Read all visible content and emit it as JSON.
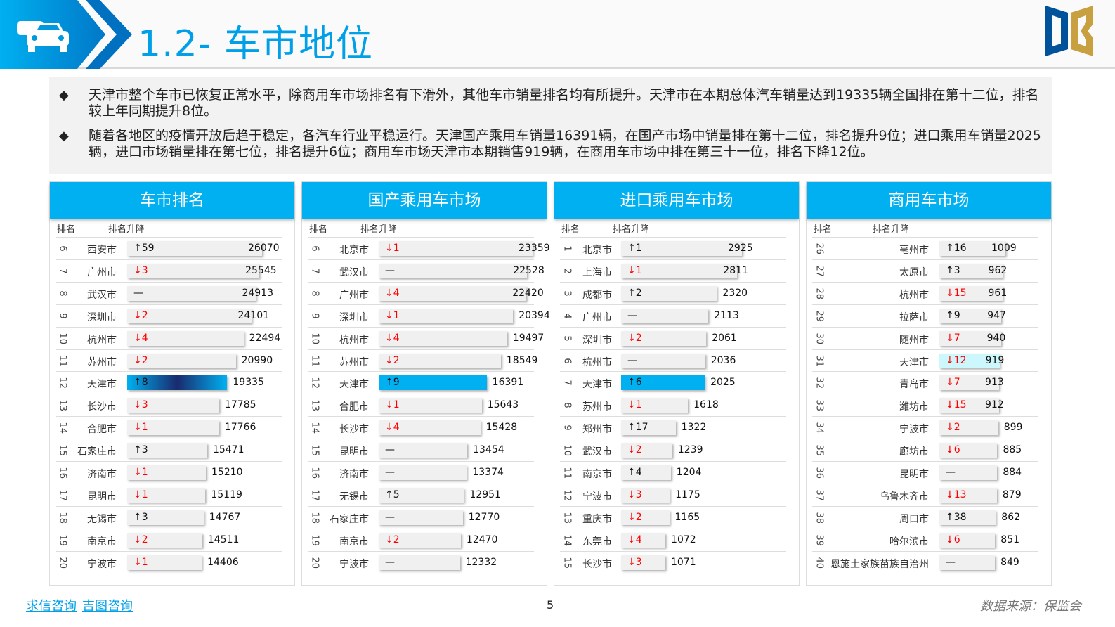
{
  "header": {
    "title": "1.2- 车市地位",
    "icon": "cars-icon",
    "logo": "DB"
  },
  "summary": [
    "天津市整个车市已恢复正常水平，除商用车市场排名有下滑外，其他车市销量排名均有所提升。天津市在本期总体汽车销量达到19335辆全国排在第十二位，排名较上年同期提升8位。",
    "随着各地区的疫情开放后趋于稳定，各汽车行业平稳运行。天津国产乘用车销量16391辆，在国产市场中销量排在第十二位，排名提升9位；进口乘用车销量2025辆，进口市场销量排在第七位，排名提升6位；商用车市场天津市本期销售919辆，在商用车市场中排在第三十一位，排名下降12位。"
  ],
  "colors": {
    "accent": "#00b0f0",
    "down": "#ff0000",
    "up": "#111111",
    "highlight_commercial": "#ccf7fc"
  },
  "panels": [
    {
      "title": "车市排名",
      "col_rank": "排名",
      "col_change": "排名升降",
      "highlight": "天津市",
      "rows": [
        [
          6,
          "西安市",
          "↑59",
          26070
        ],
        [
          7,
          "广州市",
          "↓3",
          25545
        ],
        [
          8,
          "武汉市",
          "—",
          24913
        ],
        [
          9,
          "深圳市",
          "↓2",
          24101
        ],
        [
          10,
          "杭州市",
          "↓4",
          22494
        ],
        [
          11,
          "苏州市",
          "↓2",
          20990
        ],
        [
          12,
          "天津市",
          "↑8",
          19335
        ],
        [
          13,
          "长沙市",
          "↓3",
          17785
        ],
        [
          14,
          "合肥市",
          "↓1",
          17766
        ],
        [
          15,
          "石家庄市",
          "↑3",
          15471
        ],
        [
          16,
          "济南市",
          "↓1",
          15210
        ],
        [
          17,
          "昆明市",
          "↓1",
          15119
        ],
        [
          18,
          "无锡市",
          "↑3",
          14767
        ],
        [
          19,
          "南京市",
          "↓2",
          14511
        ],
        [
          20,
          "宁波市",
          "↓1",
          14406
        ]
      ]
    },
    {
      "title": "国产乘用车市场",
      "col_rank": "排名",
      "col_change": "排名升降",
      "highlight": "天津市",
      "rows": [
        [
          6,
          "北京市",
          "↓1",
          23359
        ],
        [
          7,
          "武汉市",
          "—",
          22528
        ],
        [
          8,
          "广州市",
          "↓4",
          22420
        ],
        [
          9,
          "深圳市",
          "↓1",
          20394
        ],
        [
          10,
          "杭州市",
          "↓4",
          19497
        ],
        [
          11,
          "苏州市",
          "↓2",
          18549
        ],
        [
          12,
          "天津市",
          "↑9",
          16391
        ],
        [
          13,
          "合肥市",
          "↓1",
          15643
        ],
        [
          14,
          "长沙市",
          "↓4",
          15428
        ],
        [
          15,
          "昆明市",
          "—",
          13454
        ],
        [
          16,
          "济南市",
          "—",
          13374
        ],
        [
          17,
          "无锡市",
          "↑5",
          12951
        ],
        [
          18,
          "石家庄市",
          "—",
          12770
        ],
        [
          19,
          "南京市",
          "↓2",
          12470
        ],
        [
          20,
          "宁波市",
          "—",
          12332
        ]
      ]
    },
    {
      "title": "进口乘用车市场",
      "col_rank": "排名",
      "col_change": "排名升降",
      "highlight": "天津市",
      "rows": [
        [
          1,
          "北京市",
          "↑1",
          2925
        ],
        [
          2,
          "上海市",
          "↓1",
          2811
        ],
        [
          3,
          "成都市",
          "↑2",
          2320
        ],
        [
          4,
          "广州市",
          "—",
          2113
        ],
        [
          5,
          "深圳市",
          "↓2",
          2061
        ],
        [
          6,
          "杭州市",
          "—",
          2036
        ],
        [
          7,
          "天津市",
          "↑6",
          2025
        ],
        [
          8,
          "苏州市",
          "↓1",
          1618
        ],
        [
          9,
          "郑州市",
          "↑17",
          1322
        ],
        [
          10,
          "武汉市",
          "↓2",
          1239
        ],
        [
          11,
          "南京市",
          "↑4",
          1204
        ],
        [
          12,
          "宁波市",
          "↓3",
          1175
        ],
        [
          13,
          "重庆市",
          "↓2",
          1165
        ],
        [
          14,
          "东莞市",
          "↓4",
          1072
        ],
        [
          15,
          "长沙市",
          "↓3",
          1071
        ]
      ]
    },
    {
      "title": "商用车市场",
      "col_rank": "排名",
      "col_change": "排名升降",
      "highlight": "天津市",
      "rows": [
        [
          26,
          "亳州市",
          "↑16",
          1009
        ],
        [
          27,
          "太原市",
          "↑3",
          962
        ],
        [
          28,
          "杭州市",
          "↓15",
          961
        ],
        [
          29,
          "拉萨市",
          "↑9",
          947
        ],
        [
          30,
          "随州市",
          "↓7",
          940
        ],
        [
          31,
          "天津市",
          "↓12",
          919
        ],
        [
          32,
          "青岛市",
          "↓7",
          913
        ],
        [
          33,
          "潍坊市",
          "↓15",
          912
        ],
        [
          34,
          "宁波市",
          "↓2",
          899
        ],
        [
          35,
          "廊坊市",
          "↓6",
          885
        ],
        [
          36,
          "昆明市",
          "—",
          884
        ],
        [
          37,
          "乌鲁木齐市",
          "↓13",
          879
        ],
        [
          38,
          "周口市",
          "↑38",
          862
        ],
        [
          39,
          "哈尔滨市",
          "↓6",
          851
        ],
        [
          40,
          "恩施土家族苗族自治州",
          "—",
          849
        ]
      ]
    }
  ],
  "footer": {
    "links": [
      "求信咨询",
      "吉图咨询"
    ],
    "page": "5",
    "source": "数据来源：保监会"
  }
}
